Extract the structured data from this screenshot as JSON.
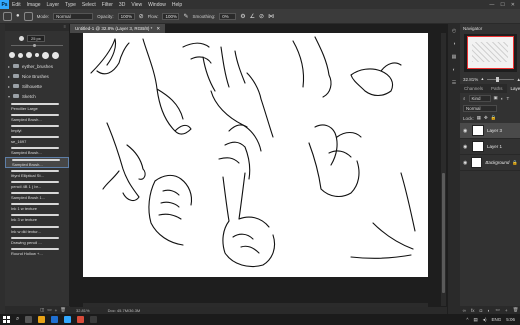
{
  "app": {
    "logo": "Ps"
  },
  "menubar": {
    "items": [
      "Edit",
      "Image",
      "Layer",
      "Type",
      "Select",
      "Filter",
      "3D",
      "View",
      "Window",
      "Help"
    ]
  },
  "options": {
    "mode_label": "Mode:",
    "mode_value": "Normal",
    "opacity_label": "Opacity:",
    "opacity_value": "100%",
    "flow_label": "Flow:",
    "flow_value": "100%",
    "smoothing_label": "Smoothing:",
    "smoothing_value": "0%"
  },
  "brushes": {
    "size_value": "25 px",
    "folders": [
      "eyther_brushes",
      "Nice Brushes",
      "Silhouette",
      "Sketch"
    ],
    "items": [
      "Pencilier Large",
      "Sampled Brush...",
      "Implyi",
      "se_1697",
      "Sampled Brush...",
      "Sampled Brush...",
      "Ittyrd Elliptical St...",
      "pencil 4B 1 ( br...",
      "Sampled Brush 1...",
      "Ink 1 w texture",
      "Ink 3 w texture",
      "Ink w dkl textur...",
      "Drawing pencil ...",
      "Round Hollow +..."
    ]
  },
  "document": {
    "tab_title": "Untitled-1 @ 32.8% (Layer 3, RGB/8) *",
    "status_zoom": "32.81%",
    "status_doc": "Doc: 45.7M/36.3M"
  },
  "navigator": {
    "title": "Navigator",
    "zoom": "32.81%"
  },
  "layers_panel": {
    "tabs": [
      "Channels",
      "Paths",
      "Layers"
    ],
    "kind": "Kind",
    "blend": "Normal",
    "lock_label": "Lock:",
    "layers": [
      {
        "name": "Layer 3",
        "selected": true
      },
      {
        "name": "Layer 1",
        "selected": false
      },
      {
        "name": "Background",
        "selected": false
      }
    ]
  },
  "taskbar": {
    "lang": "ENG",
    "time": "5:06"
  }
}
